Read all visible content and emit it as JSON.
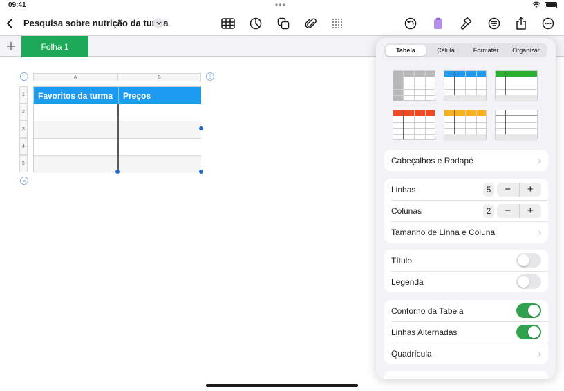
{
  "status": {
    "time": "09:41",
    "dots": "•••"
  },
  "document": {
    "title": "Pesquisa sobre nutrição da turma"
  },
  "toolbar": {
    "icons": [
      "table-icon",
      "chart-icon",
      "shapes-icon",
      "attachment-icon",
      "grid-icon",
      "undo-icon",
      "clipboard-icon",
      "format-brush-icon",
      "list-icon",
      "share-icon",
      "more-icon"
    ]
  },
  "sheets": {
    "active": "Folha 1"
  },
  "table": {
    "col_letters": [
      "A",
      "B"
    ],
    "row_numbers": [
      "1",
      "2",
      "3",
      "4",
      "5"
    ],
    "header_cells": [
      "Favoritos da turma",
      "Preços"
    ]
  },
  "inspector": {
    "tabs": [
      {
        "label": "Tabela",
        "active": true
      },
      {
        "label": "Célula",
        "active": false
      },
      {
        "label": "Formatar",
        "active": false
      },
      {
        "label": "Organizar",
        "active": false
      }
    ],
    "style_colors": [
      "#b8b8b8",
      "#1d9bf0",
      "#2bb136",
      "#f04a24",
      "#f6b21e",
      "#ffffff"
    ],
    "headers_footer": "Cabeçalhos e Rodapé",
    "rows_label": "Linhas",
    "rows_value": "5",
    "cols_label": "Colunas",
    "cols_value": "2",
    "row_col_size": "Tamanho de Linha e Coluna",
    "title_label": "Título",
    "title_on": false,
    "caption_label": "Legenda",
    "caption_on": false,
    "outline_label": "Contorno da Tabela",
    "outline_on": true,
    "alternating_label": "Linhas Alternadas",
    "alternating_on": true,
    "gridlines_label": "Quadrícula",
    "minus": "−",
    "plus": "+",
    "chevron": "›"
  }
}
